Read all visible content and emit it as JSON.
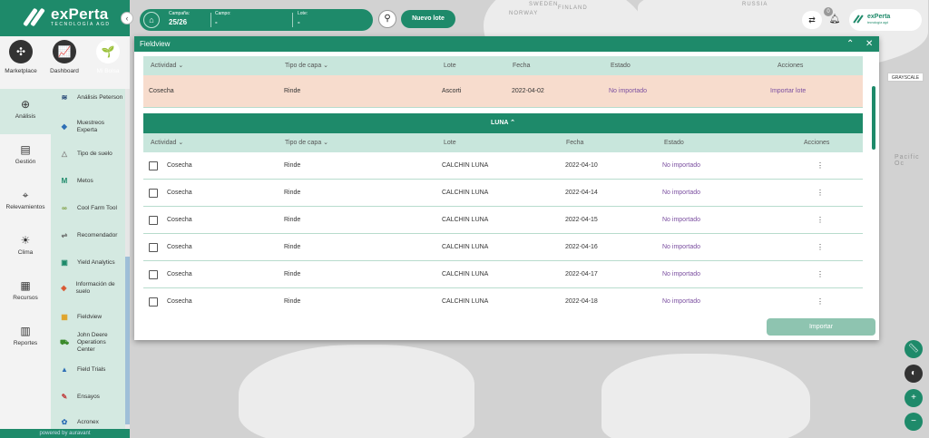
{
  "brand": {
    "name": "exPerta",
    "subtitle": "TECNOLOGÍA AGD"
  },
  "apps": [
    {
      "label": "Marketplace",
      "icon": "puzzle-icon"
    },
    {
      "label": "Dashboard",
      "icon": "chart-icon"
    },
    {
      "label": "Mi Bolsa",
      "icon": "plant-icon"
    }
  ],
  "nav": [
    {
      "label": "Análisis",
      "icon": "analysis-icon"
    },
    {
      "label": "Gestión",
      "icon": "management-icon"
    },
    {
      "label": "Relevamientos",
      "icon": "survey-icon"
    },
    {
      "label": "Clima",
      "icon": "weather-icon"
    },
    {
      "label": "Recursos",
      "icon": "resources-icon"
    },
    {
      "label": "Reportes",
      "icon": "reports-icon"
    }
  ],
  "subnav": [
    {
      "label": "Análisis Peterson",
      "icon": "peterson-icon"
    },
    {
      "label": "Muestreos Experta",
      "icon": "samples-icon"
    },
    {
      "label": "Tipo de suelo",
      "icon": "soil-icon"
    },
    {
      "label": "Metos",
      "icon": "metos-icon"
    },
    {
      "label": "Cool Farm Tool",
      "icon": "coolfarm-icon"
    },
    {
      "label": "Recomendador",
      "icon": "recommender-icon"
    },
    {
      "label": "Yield Analytics",
      "icon": "yield-icon"
    },
    {
      "label": "Información de suelo",
      "icon": "soil-info-icon"
    },
    {
      "label": "Fieldview",
      "icon": "fieldview-icon"
    },
    {
      "label": "John Deere Operations Center",
      "icon": "tractor-icon"
    },
    {
      "label": "Field Trials",
      "icon": "field-trials-icon"
    },
    {
      "label": "Ensayos",
      "icon": "trials-icon"
    },
    {
      "label": "Acronex",
      "icon": "acronex-icon"
    }
  ],
  "powered_by": "powered by auravant",
  "topbar": {
    "campaign_label": "Campaña:",
    "campaign_value": "25/26",
    "field_label": "Campo:",
    "field_value": "-",
    "lot_label": "Lote:",
    "lot_value": "-",
    "new_lot": "Nuevo lote"
  },
  "notifications": {
    "count": "0"
  },
  "user": {
    "initial": "D",
    "brand": "exPerta",
    "brand_sub": "tecnología agd"
  },
  "map": {
    "grayscale": "GRAYSCALE",
    "labels": [
      "SWEDEN",
      "FINLAND",
      "NORWAY",
      "RUSSIA",
      "Pacific Oc"
    ]
  },
  "modal": {
    "title": "Fieldview",
    "columns": [
      "Actividad",
      "Tipo de capa",
      "Lote",
      "Fecha",
      "Estado",
      "Acciones"
    ],
    "top_row": {
      "actividad": "Cosecha",
      "tipo": "Rinde",
      "lote": "Ascorti",
      "fecha": "2022-04-02",
      "estado": "No importado",
      "accion": "Importar lote"
    },
    "group": {
      "name": "LUNA"
    },
    "rows": [
      {
        "actividad": "Cosecha",
        "tipo": "Rinde",
        "lote": "CALCHIN LUNA",
        "fecha": "2022-04-10",
        "estado": "No importado"
      },
      {
        "actividad": "Cosecha",
        "tipo": "Rinde",
        "lote": "CALCHIN LUNA",
        "fecha": "2022-04-14",
        "estado": "No importado"
      },
      {
        "actividad": "Cosecha",
        "tipo": "Rinde",
        "lote": "CALCHIN LUNA",
        "fecha": "2022-04-15",
        "estado": "No importado"
      },
      {
        "actividad": "Cosecha",
        "tipo": "Rinde",
        "lote": "CALCHIN LUNA",
        "fecha": "2022-04-16",
        "estado": "No importado"
      },
      {
        "actividad": "Cosecha",
        "tipo": "Rinde",
        "lote": "CALCHIN LUNA",
        "fecha": "2022-04-17",
        "estado": "No importado"
      },
      {
        "actividad": "Cosecha",
        "tipo": "Rinde",
        "lote": "CALCHIN LUNA",
        "fecha": "2022-04-18",
        "estado": "No importado"
      }
    ],
    "import_button": "Importar"
  },
  "colors": {
    "primary": "#1e8a6a",
    "header_light": "#c8e6dc",
    "highlight_row": "#f7dccd",
    "status": "#7b4fa0"
  }
}
